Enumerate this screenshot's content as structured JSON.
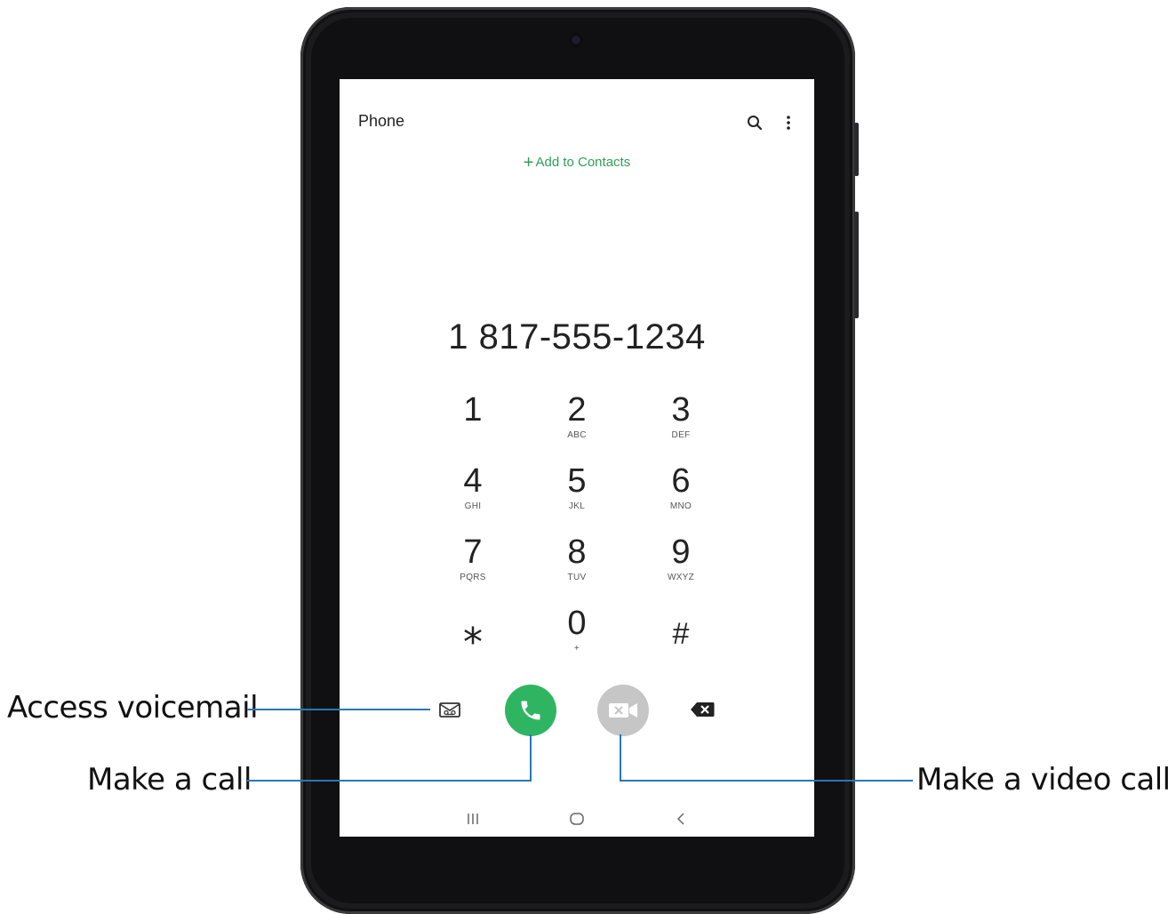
{
  "app": {
    "title": "Phone",
    "search_icon": "search-icon",
    "more_icon": "more-vertical-icon",
    "add_contacts_label": "Add to Contacts",
    "accent_color": "#2fb561"
  },
  "dialer": {
    "number": "1 817-555-1234",
    "keys": [
      {
        "digit": "1",
        "letters": ""
      },
      {
        "digit": "2",
        "letters": "ABC"
      },
      {
        "digit": "3",
        "letters": "DEF"
      },
      {
        "digit": "4",
        "letters": "GHI"
      },
      {
        "digit": "5",
        "letters": "JKL"
      },
      {
        "digit": "6",
        "letters": "MNO"
      },
      {
        "digit": "7",
        "letters": "PQRS"
      },
      {
        "digit": "8",
        "letters": "TUV"
      },
      {
        "digit": "9",
        "letters": "WXYZ"
      },
      {
        "digit": "⁎",
        "letters": ""
      },
      {
        "digit": "0",
        "letters": "+"
      },
      {
        "digit": "#",
        "letters": ""
      }
    ]
  },
  "actions": {
    "voicemail_icon": "voicemail-icon",
    "call_icon": "phone-icon",
    "video_icon": "video-camera-icon",
    "backspace_icon": "backspace-icon"
  },
  "navbar": {
    "recents_icon": "recents-icon",
    "home_icon": "home-icon",
    "back_icon": "back-icon"
  },
  "callouts": {
    "voicemail": "Access voicemail",
    "call": "Make a call",
    "video": "Make a video call"
  }
}
